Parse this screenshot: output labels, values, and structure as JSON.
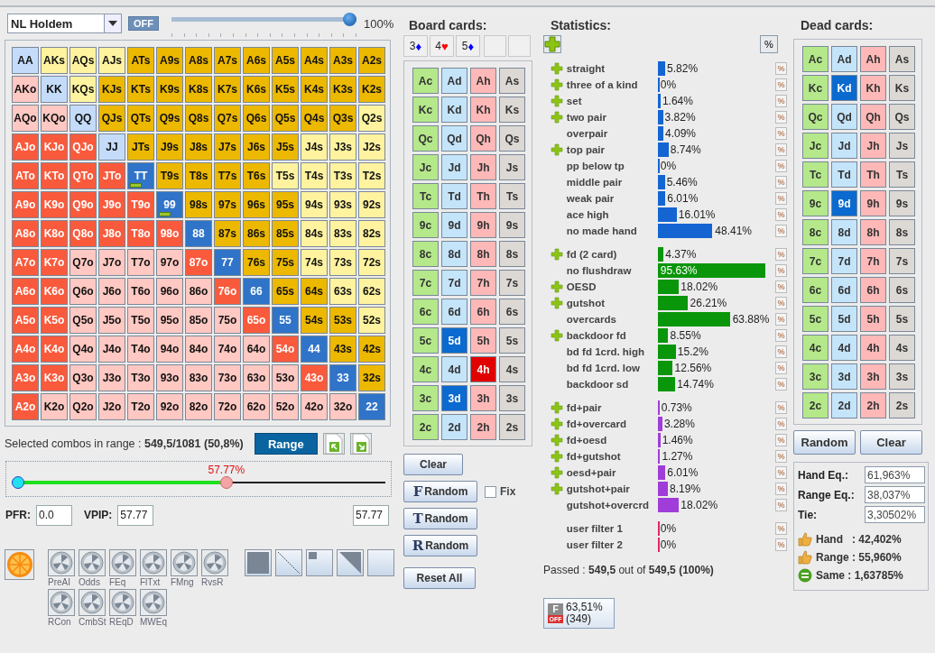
{
  "game_select": {
    "value": "NL Holdem"
  },
  "toggle": {
    "label": "OFF"
  },
  "weight_slider": {
    "level": 1.0,
    "reading": "100%"
  },
  "hand_grid": [
    [
      {
        "label": "AA",
        "color": "#c4dcfa",
        "marked": false
      },
      {
        "label": "AKs",
        "color": "#fff3a0",
        "marked": false
      },
      {
        "label": "AQs",
        "color": "#fff3a0",
        "marked": false
      },
      {
        "label": "AJs",
        "color": "#fff3a0",
        "marked": false
      },
      {
        "label": "ATs",
        "color": "#ecb800",
        "marked": false
      },
      {
        "label": "A9s",
        "color": "#ecb800",
        "marked": false
      },
      {
        "label": "A8s",
        "color": "#ecb800",
        "marked": false
      },
      {
        "label": "A7s",
        "color": "#ecb800",
        "marked": false
      },
      {
        "label": "A6s",
        "color": "#ecb800",
        "marked": false
      },
      {
        "label": "A5s",
        "color": "#ecb800",
        "marked": false
      },
      {
        "label": "A4s",
        "color": "#ecb800",
        "marked": false
      },
      {
        "label": "A3s",
        "color": "#ecb800",
        "marked": false
      },
      {
        "label": "A2s",
        "color": "#ecb800",
        "marked": false
      }
    ],
    [
      {
        "label": "AKo",
        "color": "#ffc8c2",
        "marked": false
      },
      {
        "label": "KK",
        "color": "#c4dcfa",
        "marked": false
      },
      {
        "label": "KQs",
        "color": "#fff3a0",
        "marked": false
      },
      {
        "label": "KJs",
        "color": "#ecb800",
        "marked": false
      },
      {
        "label": "KTs",
        "color": "#ecb800",
        "marked": false
      },
      {
        "label": "K9s",
        "color": "#ecb800",
        "marked": false
      },
      {
        "label": "K8s",
        "color": "#ecb800",
        "marked": false
      },
      {
        "label": "K7s",
        "color": "#ecb800",
        "marked": false
      },
      {
        "label": "K6s",
        "color": "#ecb800",
        "marked": false
      },
      {
        "label": "K5s",
        "color": "#ecb800",
        "marked": false
      },
      {
        "label": "K4s",
        "color": "#ecb800",
        "marked": false
      },
      {
        "label": "K3s",
        "color": "#ecb800",
        "marked": false
      },
      {
        "label": "K2s",
        "color": "#ecb800",
        "marked": false
      }
    ],
    [
      {
        "label": "AQo",
        "color": "#ffc8c2",
        "marked": false
      },
      {
        "label": "KQo",
        "color": "#ffc8c2",
        "marked": false
      },
      {
        "label": "QQ",
        "color": "#c4dcfa",
        "marked": false
      },
      {
        "label": "QJs",
        "color": "#ecb800",
        "marked": false
      },
      {
        "label": "QTs",
        "color": "#ecb800",
        "marked": false
      },
      {
        "label": "Q9s",
        "color": "#ecb800",
        "marked": false
      },
      {
        "label": "Q8s",
        "color": "#ecb800",
        "marked": false
      },
      {
        "label": "Q7s",
        "color": "#ecb800",
        "marked": false
      },
      {
        "label": "Q6s",
        "color": "#ecb800",
        "marked": false
      },
      {
        "label": "Q5s",
        "color": "#ecb800",
        "marked": false
      },
      {
        "label": "Q4s",
        "color": "#ecb800",
        "marked": false
      },
      {
        "label": "Q3s",
        "color": "#ecb800",
        "marked": false
      },
      {
        "label": "Q2s",
        "color": "#fff3a0",
        "marked": false
      }
    ],
    [
      {
        "label": "AJo",
        "color": "#fa5a3c",
        "marked": false
      },
      {
        "label": "KJo",
        "color": "#fa5a3c",
        "marked": false
      },
      {
        "label": "QJo",
        "color": "#fa5a3c",
        "marked": false
      },
      {
        "label": "JJ",
        "color": "#c4dcfa",
        "marked": false
      },
      {
        "label": "JTs",
        "color": "#ecb800",
        "marked": false
      },
      {
        "label": "J9s",
        "color": "#ecb800",
        "marked": false
      },
      {
        "label": "J8s",
        "color": "#ecb800",
        "marked": false
      },
      {
        "label": "J7s",
        "color": "#ecb800",
        "marked": false
      },
      {
        "label": "J6s",
        "color": "#ecb800",
        "marked": false
      },
      {
        "label": "J5s",
        "color": "#ecb800",
        "marked": false
      },
      {
        "label": "J4s",
        "color": "#fff3a0",
        "marked": false
      },
      {
        "label": "J3s",
        "color": "#fff3a0",
        "marked": false
      },
      {
        "label": "J2s",
        "color": "#fff3a0",
        "marked": false
      }
    ],
    [
      {
        "label": "ATo",
        "color": "#fa5a3c",
        "marked": false
      },
      {
        "label": "KTo",
        "color": "#fa5a3c",
        "marked": false
      },
      {
        "label": "QTo",
        "color": "#fa5a3c",
        "marked": false
      },
      {
        "label": "JTo",
        "color": "#fa5a3c",
        "marked": false
      },
      {
        "label": "TT",
        "color": "#2f74c8",
        "marked": true
      },
      {
        "label": "T9s",
        "color": "#ecb800",
        "marked": false
      },
      {
        "label": "T8s",
        "color": "#ecb800",
        "marked": false
      },
      {
        "label": "T7s",
        "color": "#ecb800",
        "marked": false
      },
      {
        "label": "T6s",
        "color": "#ecb800",
        "marked": false
      },
      {
        "label": "T5s",
        "color": "#fff3a0",
        "marked": false
      },
      {
        "label": "T4s",
        "color": "#fff3a0",
        "marked": false
      },
      {
        "label": "T3s",
        "color": "#fff3a0",
        "marked": false
      },
      {
        "label": "T2s",
        "color": "#fff3a0",
        "marked": false
      }
    ],
    [
      {
        "label": "A9o",
        "color": "#fa5a3c",
        "marked": false
      },
      {
        "label": "K9o",
        "color": "#fa5a3c",
        "marked": false
      },
      {
        "label": "Q9o",
        "color": "#fa5a3c",
        "marked": false
      },
      {
        "label": "J9o",
        "color": "#fa5a3c",
        "marked": false
      },
      {
        "label": "T9o",
        "color": "#fa5a3c",
        "marked": false
      },
      {
        "label": "99",
        "color": "#2f74c8",
        "marked": true
      },
      {
        "label": "98s",
        "color": "#ecb800",
        "marked": false
      },
      {
        "label": "97s",
        "color": "#ecb800",
        "marked": false
      },
      {
        "label": "96s",
        "color": "#ecb800",
        "marked": false
      },
      {
        "label": "95s",
        "color": "#ecb800",
        "marked": false
      },
      {
        "label": "94s",
        "color": "#fff3a0",
        "marked": false
      },
      {
        "label": "93s",
        "color": "#fff3a0",
        "marked": false
      },
      {
        "label": "92s",
        "color": "#fff3a0",
        "marked": false
      }
    ],
    [
      {
        "label": "A8o",
        "color": "#fa5a3c",
        "marked": false
      },
      {
        "label": "K8o",
        "color": "#fa5a3c",
        "marked": false
      },
      {
        "label": "Q8o",
        "color": "#fa5a3c",
        "marked": false
      },
      {
        "label": "J8o",
        "color": "#fa5a3c",
        "marked": false
      },
      {
        "label": "T8o",
        "color": "#fa5a3c",
        "marked": false
      },
      {
        "label": "98o",
        "color": "#fa5a3c",
        "marked": false
      },
      {
        "label": "88",
        "color": "#2f74c8",
        "marked": false
      },
      {
        "label": "87s",
        "color": "#ecb800",
        "marked": false
      },
      {
        "label": "86s",
        "color": "#ecb800",
        "marked": false
      },
      {
        "label": "85s",
        "color": "#ecb800",
        "marked": false
      },
      {
        "label": "84s",
        "color": "#fff3a0",
        "marked": false
      },
      {
        "label": "83s",
        "color": "#fff3a0",
        "marked": false
      },
      {
        "label": "82s",
        "color": "#fff3a0",
        "marked": false
      }
    ],
    [
      {
        "label": "A7o",
        "color": "#fa5a3c",
        "marked": false
      },
      {
        "label": "K7o",
        "color": "#fa5a3c",
        "marked": false
      },
      {
        "label": "Q7o",
        "color": "#ffc8c2",
        "marked": false
      },
      {
        "label": "J7o",
        "color": "#ffc8c2",
        "marked": false
      },
      {
        "label": "T7o",
        "color": "#ffc8c2",
        "marked": false
      },
      {
        "label": "97o",
        "color": "#ffc8c2",
        "marked": false
      },
      {
        "label": "87o",
        "color": "#fa5a3c",
        "marked": false
      },
      {
        "label": "77",
        "color": "#2f74c8",
        "marked": false
      },
      {
        "label": "76s",
        "color": "#ecb800",
        "marked": false
      },
      {
        "label": "75s",
        "color": "#ecb800",
        "marked": false
      },
      {
        "label": "74s",
        "color": "#fff3a0",
        "marked": false
      },
      {
        "label": "73s",
        "color": "#fff3a0",
        "marked": false
      },
      {
        "label": "72s",
        "color": "#fff3a0",
        "marked": false
      }
    ],
    [
      {
        "label": "A6o",
        "color": "#fa5a3c",
        "marked": false
      },
      {
        "label": "K6o",
        "color": "#fa5a3c",
        "marked": false
      },
      {
        "label": "Q6o",
        "color": "#ffc8c2",
        "marked": false
      },
      {
        "label": "J6o",
        "color": "#ffc8c2",
        "marked": false
      },
      {
        "label": "T6o",
        "color": "#ffc8c2",
        "marked": false
      },
      {
        "label": "96o",
        "color": "#ffc8c2",
        "marked": false
      },
      {
        "label": "86o",
        "color": "#ffc8c2",
        "marked": false
      },
      {
        "label": "76o",
        "color": "#fa5a3c",
        "marked": false
      },
      {
        "label": "66",
        "color": "#2f74c8",
        "marked": false
      },
      {
        "label": "65s",
        "color": "#ecb800",
        "marked": false
      },
      {
        "label": "64s",
        "color": "#ecb800",
        "marked": false
      },
      {
        "label": "63s",
        "color": "#fff3a0",
        "marked": false
      },
      {
        "label": "62s",
        "color": "#fff3a0",
        "marked": false
      }
    ],
    [
      {
        "label": "A5o",
        "color": "#fa5a3c",
        "marked": false
      },
      {
        "label": "K5o",
        "color": "#fa5a3c",
        "marked": false
      },
      {
        "label": "Q5o",
        "color": "#ffc8c2",
        "marked": false
      },
      {
        "label": "J5o",
        "color": "#ffc8c2",
        "marked": false
      },
      {
        "label": "T5o",
        "color": "#ffc8c2",
        "marked": false
      },
      {
        "label": "95o",
        "color": "#ffc8c2",
        "marked": false
      },
      {
        "label": "85o",
        "color": "#ffc8c2",
        "marked": false
      },
      {
        "label": "75o",
        "color": "#ffc8c2",
        "marked": false
      },
      {
        "label": "65o",
        "color": "#fa5a3c",
        "marked": false
      },
      {
        "label": "55",
        "color": "#2f74c8",
        "marked": false
      },
      {
        "label": "54s",
        "color": "#ecb800",
        "marked": false
      },
      {
        "label": "53s",
        "color": "#ecb800",
        "marked": false
      },
      {
        "label": "52s",
        "color": "#fff3a0",
        "marked": false
      }
    ],
    [
      {
        "label": "A4o",
        "color": "#fa5a3c",
        "marked": false
      },
      {
        "label": "K4o",
        "color": "#fa5a3c",
        "marked": false
      },
      {
        "label": "Q4o",
        "color": "#ffc8c2",
        "marked": false
      },
      {
        "label": "J4o",
        "color": "#ffc8c2",
        "marked": false
      },
      {
        "label": "T4o",
        "color": "#ffc8c2",
        "marked": false
      },
      {
        "label": "94o",
        "color": "#ffc8c2",
        "marked": false
      },
      {
        "label": "84o",
        "color": "#ffc8c2",
        "marked": false
      },
      {
        "label": "74o",
        "color": "#ffc8c2",
        "marked": false
      },
      {
        "label": "64o",
        "color": "#ffc8c2",
        "marked": false
      },
      {
        "label": "54o",
        "color": "#fa5a3c",
        "marked": false
      },
      {
        "label": "44",
        "color": "#2f74c8",
        "marked": false
      },
      {
        "label": "43s",
        "color": "#ecb800",
        "marked": false
      },
      {
        "label": "42s",
        "color": "#ecb800",
        "marked": false
      }
    ],
    [
      {
        "label": "A3o",
        "color": "#fa5a3c",
        "marked": false
      },
      {
        "label": "K3o",
        "color": "#fa5a3c",
        "marked": false
      },
      {
        "label": "Q3o",
        "color": "#ffc8c2",
        "marked": false
      },
      {
        "label": "J3o",
        "color": "#ffc8c2",
        "marked": false
      },
      {
        "label": "T3o",
        "color": "#ffc8c2",
        "marked": false
      },
      {
        "label": "93o",
        "color": "#ffc8c2",
        "marked": false
      },
      {
        "label": "83o",
        "color": "#ffc8c2",
        "marked": false
      },
      {
        "label": "73o",
        "color": "#ffc8c2",
        "marked": false
      },
      {
        "label": "63o",
        "color": "#ffc8c2",
        "marked": false
      },
      {
        "label": "53o",
        "color": "#ffc8c2",
        "marked": false
      },
      {
        "label": "43o",
        "color": "#fa5a3c",
        "marked": false
      },
      {
        "label": "33",
        "color": "#2f74c8",
        "marked": false
      },
      {
        "label": "32s",
        "color": "#ecb800",
        "marked": false
      }
    ],
    [
      {
        "label": "A2o",
        "color": "#fa5a3c",
        "marked": false
      },
      {
        "label": "K2o",
        "color": "#ffc8c2",
        "marked": false
      },
      {
        "label": "Q2o",
        "color": "#ffc8c2",
        "marked": false
      },
      {
        "label": "J2o",
        "color": "#ffc8c2",
        "marked": false
      },
      {
        "label": "T2o",
        "color": "#ffc8c2",
        "marked": false
      },
      {
        "label": "92o",
        "color": "#ffc8c2",
        "marked": false
      },
      {
        "label": "82o",
        "color": "#ffc8c2",
        "marked": false
      },
      {
        "label": "72o",
        "color": "#ffc8c2",
        "marked": false
      },
      {
        "label": "62o",
        "color": "#ffc8c2",
        "marked": false
      },
      {
        "label": "52o",
        "color": "#ffc8c2",
        "marked": false
      },
      {
        "label": "42o",
        "color": "#ffc8c2",
        "marked": false
      },
      {
        "label": "32o",
        "color": "#ffc8c2",
        "marked": false
      },
      {
        "label": "22",
        "color": "#2f74c8",
        "marked": false
      }
    ]
  ],
  "combos": {
    "text": "Selected combos in range : **549,5/1081 (50,8%)**",
    "button": "Range"
  },
  "range_slider": {
    "level": 0.5777,
    "reading": "57.77%"
  },
  "stats_fields": [
    {
      "label": "PFR:",
      "value": "0.0"
    },
    {
      "label": "VPIP:",
      "value": "57.77"
    },
    {
      "value": "57.77"
    }
  ],
  "tools": [
    {
      "label": "PreAI"
    },
    {
      "label": "Odds"
    },
    {
      "label": "FEq"
    },
    {
      "label": "FlTxt"
    },
    {
      "label": "FMng"
    },
    {
      "label": "RvsR"
    },
    {
      "label": "RCon"
    },
    {
      "label": "CmbSt"
    },
    {
      "label": "REqD"
    },
    {
      "label": "MWEq"
    }
  ],
  "board": {
    "title": "Board cards:",
    "slots": [
      {
        "kind": "card",
        "rank": "3",
        "suit": "♦",
        "color": "#0000ff"
      },
      {
        "kind": "card",
        "rank": "4",
        "suit": "♥",
        "color": "#ff0000"
      },
      {
        "kind": "card",
        "rank": "5",
        "suit": "♦",
        "color": "#0000ff"
      },
      {
        "kind": "empty"
      },
      {
        "kind": "empty"
      }
    ],
    "cards": [
      [
        {
          "label": "Ac",
          "selected": false
        },
        {
          "label": "Ad",
          "selected": false
        },
        {
          "label": "Ah",
          "selected": false
        },
        {
          "label": "As",
          "selected": false
        }
      ],
      [
        {
          "label": "Kc",
          "selected": false
        },
        {
          "label": "Kd",
          "selected": false
        },
        {
          "label": "Kh",
          "selected": false
        },
        {
          "label": "Ks",
          "selected": false
        }
      ],
      [
        {
          "label": "Qc",
          "selected": false
        },
        {
          "label": "Qd",
          "selected": false
        },
        {
          "label": "Qh",
          "selected": false
        },
        {
          "label": "Qs",
          "selected": false
        }
      ],
      [
        {
          "label": "Jc",
          "selected": false
        },
        {
          "label": "Jd",
          "selected": false
        },
        {
          "label": "Jh",
          "selected": false
        },
        {
          "label": "Js",
          "selected": false
        }
      ],
      [
        {
          "label": "Tc",
          "selected": false
        },
        {
          "label": "Td",
          "selected": false
        },
        {
          "label": "Th",
          "selected": false
        },
        {
          "label": "Ts",
          "selected": false
        }
      ],
      [
        {
          "label": "9c",
          "selected": false
        },
        {
          "label": "9d",
          "selected": false
        },
        {
          "label": "9h",
          "selected": false
        },
        {
          "label": "9s",
          "selected": false
        }
      ],
      [
        {
          "label": "8c",
          "selected": false
        },
        {
          "label": "8d",
          "selected": false
        },
        {
          "label": "8h",
          "selected": false
        },
        {
          "label": "8s",
          "selected": false
        }
      ],
      [
        {
          "label": "7c",
          "selected": false
        },
        {
          "label": "7d",
          "selected": false
        },
        {
          "label": "7h",
          "selected": false
        },
        {
          "label": "7s",
          "selected": false
        }
      ],
      [
        {
          "label": "6c",
          "selected": false
        },
        {
          "label": "6d",
          "selected": false
        },
        {
          "label": "6h",
          "selected": false
        },
        {
          "label": "6s",
          "selected": false
        }
      ],
      [
        {
          "label": "5c",
          "selected": false
        },
        {
          "label": "5d",
          "selected": true
        },
        {
          "label": "5h",
          "selected": false
        },
        {
          "label": "5s",
          "selected": false
        }
      ],
      [
        {
          "label": "4c",
          "selected": false
        },
        {
          "label": "4d",
          "selected": false
        },
        {
          "label": "4h",
          "selected": true
        },
        {
          "label": "4s",
          "selected": false
        }
      ],
      [
        {
          "label": "3c",
          "selected": false
        },
        {
          "label": "3d",
          "selected": true
        },
        {
          "label": "3h",
          "selected": false
        },
        {
          "label": "3s",
          "selected": false
        }
      ],
      [
        {
          "label": "2c",
          "selected": false
        },
        {
          "label": "2d",
          "selected": false
        },
        {
          "label": "2h",
          "selected": false
        },
        {
          "label": "2s",
          "selected": false
        }
      ]
    ],
    "clear": "Clear",
    "random_buttons": [
      {
        "letter": "F",
        "label": "Random"
      },
      {
        "letter": "T",
        "label": "Random"
      },
      {
        "letter": "R",
        "label": "Random"
      }
    ],
    "fix": {
      "label": "Fix",
      "checked": false
    },
    "reset": "Reset All"
  },
  "statistics": {
    "title": "Statistics:",
    "percent_button": "%",
    "groups": [
      {
        "color": "#1464d2",
        "rows": [
          {
            "label": "straight",
            "plus": true,
            "level": 0.0582,
            "reading": "5.82%"
          },
          {
            "label": "three of a kind",
            "plus": true,
            "level": 0,
            "reading": "0%"
          },
          {
            "label": "set",
            "plus": true,
            "level": 0.0164,
            "reading": "1.64%"
          },
          {
            "label": "two pair",
            "plus": true,
            "level": 0.0382,
            "reading": "3.82%"
          },
          {
            "label": "overpair",
            "plus": false,
            "level": 0.0409,
            "reading": "4.09%"
          },
          {
            "label": "top pair",
            "plus": true,
            "level": 0.0874,
            "reading": "8.74%"
          },
          {
            "label": "pp below tp",
            "plus": false,
            "level": 0,
            "reading": "0%"
          },
          {
            "label": "middle pair",
            "plus": false,
            "level": 0.0546,
            "reading": "5.46%"
          },
          {
            "label": "weak pair",
            "plus": false,
            "level": 0.0601,
            "reading": "6.01%"
          },
          {
            "label": "ace high",
            "plus": false,
            "level": 0.1601,
            "reading": "16.01%"
          },
          {
            "label": "no made hand",
            "plus": false,
            "level": 0.4841,
            "reading": "48.41%"
          }
        ]
      },
      {
        "color": "#0a960a",
        "rows": [
          {
            "label": "fd (2 card)",
            "plus": true,
            "level": 0.0437,
            "reading": "4.37%"
          },
          {
            "label": "no flushdraw",
            "plus": false,
            "level": 0.9563,
            "reading": "95.63%"
          },
          {
            "label": "OESD",
            "plus": true,
            "level": 0.1802,
            "reading": "18.02%"
          },
          {
            "label": "gutshot",
            "plus": true,
            "level": 0.2621,
            "reading": "26.21%"
          },
          {
            "label": "overcards",
            "plus": false,
            "level": 0.6388,
            "reading": "63.88%"
          },
          {
            "label": "backdoor fd",
            "plus": true,
            "level": 0.0855,
            "reading": "8.55%"
          },
          {
            "label": "bd fd 1crd. high",
            "plus": false,
            "level": 0.152,
            "reading": "15.2%"
          },
          {
            "label": "bd fd 1crd. low",
            "plus": false,
            "level": 0.1256,
            "reading": "12.56%"
          },
          {
            "label": "backdoor sd",
            "plus": false,
            "level": 0.1474,
            "reading": "14.74%"
          }
        ]
      },
      {
        "color": "#a03cd8",
        "rows": [
          {
            "label": "fd+pair",
            "plus": true,
            "level": 0.0073,
            "reading": "0.73%"
          },
          {
            "label": "fd+overcard",
            "plus": true,
            "level": 0.0328,
            "reading": "3.28%"
          },
          {
            "label": "fd+oesd",
            "plus": true,
            "level": 0.0146,
            "reading": "1.46%"
          },
          {
            "label": "fd+gutshot",
            "plus": true,
            "level": 0.0127,
            "reading": "1.27%"
          },
          {
            "label": "oesd+pair",
            "plus": true,
            "level": 0.0601,
            "reading": "6.01%"
          },
          {
            "label": "gutshot+pair",
            "plus": true,
            "level": 0.0819,
            "reading": "8.19%"
          },
          {
            "label": "gutshot+overcrd",
            "plus": false,
            "level": 0.1802,
            "reading": "18.02%"
          }
        ]
      },
      {
        "color": "#e02860",
        "rows": [
          {
            "label": "user filter 1",
            "plus": false,
            "level": 0,
            "reading": "0%"
          },
          {
            "label": "user filter 2",
            "plus": false,
            "level": 0,
            "reading": "0%"
          }
        ]
      }
    ],
    "passed": "Passed : **549,5** out of **549,5 (100%)**",
    "badge": {
      "top": "F",
      "bottom": "OFF",
      "value": "63,51%",
      "count": "(349)"
    }
  },
  "dead": {
    "title": "Dead cards:",
    "cards": [
      [
        {
          "label": "Ac",
          "selected": false
        },
        {
          "label": "Ad",
          "selected": false
        },
        {
          "label": "Ah",
          "selected": false
        },
        {
          "label": "As",
          "selected": false
        }
      ],
      [
        {
          "label": "Kc",
          "selected": false
        },
        {
          "label": "Kd",
          "selected": true
        },
        {
          "label": "Kh",
          "selected": false
        },
        {
          "label": "Ks",
          "selected": false
        }
      ],
      [
        {
          "label": "Qc",
          "selected": false
        },
        {
          "label": "Qd",
          "selected": false
        },
        {
          "label": "Qh",
          "selected": false
        },
        {
          "label": "Qs",
          "selected": false
        }
      ],
      [
        {
          "label": "Jc",
          "selected": false
        },
        {
          "label": "Jd",
          "selected": false
        },
        {
          "label": "Jh",
          "selected": false
        },
        {
          "label": "Js",
          "selected": false
        }
      ],
      [
        {
          "label": "Tc",
          "selected": false
        },
        {
          "label": "Td",
          "selected": false
        },
        {
          "label": "Th",
          "selected": false
        },
        {
          "label": "Ts",
          "selected": false
        }
      ],
      [
        {
          "label": "9c",
          "selected": false
        },
        {
          "label": "9d",
          "selected": true
        },
        {
          "label": "9h",
          "selected": false
        },
        {
          "label": "9s",
          "selected": false
        }
      ],
      [
        {
          "label": "8c",
          "selected": false
        },
        {
          "label": "8d",
          "selected": false
        },
        {
          "label": "8h",
          "selected": false
        },
        {
          "label": "8s",
          "selected": false
        }
      ],
      [
        {
          "label": "7c",
          "selected": false
        },
        {
          "label": "7d",
          "selected": false
        },
        {
          "label": "7h",
          "selected": false
        },
        {
          "label": "7s",
          "selected": false
        }
      ],
      [
        {
          "label": "6c",
          "selected": false
        },
        {
          "label": "6d",
          "selected": false
        },
        {
          "label": "6h",
          "selected": false
        },
        {
          "label": "6s",
          "selected": false
        }
      ],
      [
        {
          "label": "5c",
          "selected": false
        },
        {
          "label": "5d",
          "selected": false
        },
        {
          "label": "5h",
          "selected": false
        },
        {
          "label": "5s",
          "selected": false
        }
      ],
      [
        {
          "label": "4c",
          "selected": false
        },
        {
          "label": "4d",
          "selected": false
        },
        {
          "label": "4h",
          "selected": false
        },
        {
          "label": "4s",
          "selected": false
        }
      ],
      [
        {
          "label": "3c",
          "selected": false
        },
        {
          "label": "3d",
          "selected": false
        },
        {
          "label": "3h",
          "selected": false
        },
        {
          "label": "3s",
          "selected": false
        }
      ],
      [
        {
          "label": "2c",
          "selected": false
        },
        {
          "label": "2d",
          "selected": false
        },
        {
          "label": "2h",
          "selected": false
        },
        {
          "label": "2s",
          "selected": false
        }
      ]
    ],
    "buttons": [
      "Random",
      "Clear"
    ]
  },
  "equity": {
    "fields": [
      {
        "label": "Hand Eq.:",
        "value": "61,963%"
      },
      {
        "label": "Range Eq.:",
        "value": "38,037%"
      },
      {
        "label": "Tie:",
        "value": "3,30502%"
      }
    ],
    "results": [
      {
        "kind": "win",
        "text": "Hand   : 42,402%"
      },
      {
        "kind": "win",
        "text": "Range : 55,960%"
      },
      {
        "kind": "tie",
        "text": "Same : 1,63785%"
      }
    ]
  }
}
